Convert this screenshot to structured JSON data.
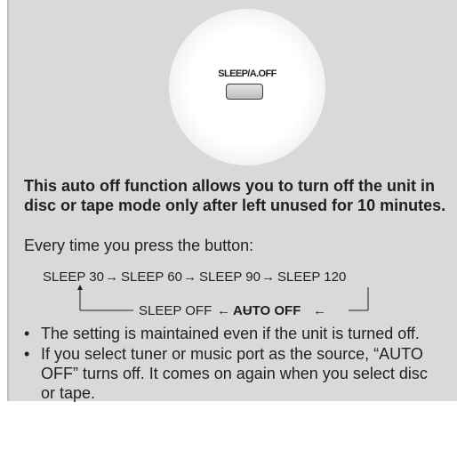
{
  "button": {
    "label": "SLEEP/A.OFF"
  },
  "heading": "This auto off function allows you to turn off the unit in disc or tape mode only after left unused for 10 minutes.",
  "lead": "Every time you press the button:",
  "flow": {
    "row1": [
      "SLEEP 30",
      "→",
      "SLEEP 60",
      "→",
      "SLEEP 90",
      "→",
      "SLEEP 120"
    ],
    "row2_left": "SLEEP OFF",
    "row2_arrow": "←",
    "row2_bold": "AUTO OFF",
    "row2_arrow_right": "←"
  },
  "bullets": [
    "The setting is maintained even if the unit is turned off.",
    "If you select tuner or music port as the source, “AUTO OFF” turns off. It comes on again when you select disc or tape."
  ],
  "bullet_glyph": "•",
  "colors": {
    "panel": "#d9d9d9",
    "text": "#231f20"
  }
}
